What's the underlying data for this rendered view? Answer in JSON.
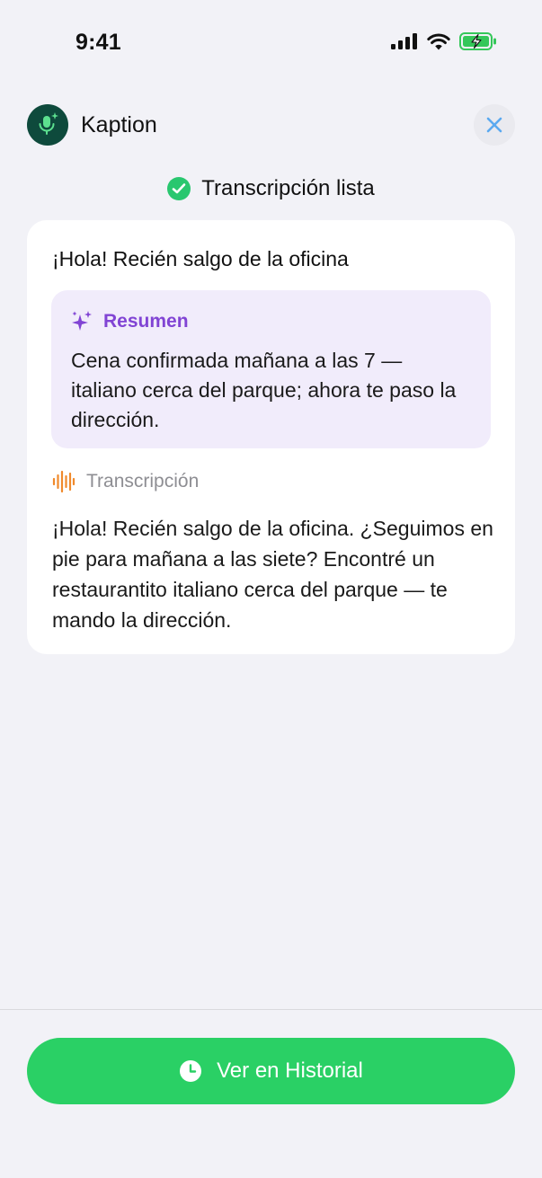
{
  "status_bar": {
    "time": "9:41"
  },
  "header": {
    "app_name": "Kaption"
  },
  "status": {
    "text": "Transcripción lista"
  },
  "card": {
    "title": "¡Hola! Recién salgo de la oficina",
    "summary": {
      "label": "Resumen",
      "text": "Cena confirmada mañana a las 7 — italiano cerca del parque; ahora te paso la dirección."
    },
    "transcription": {
      "label": "Transcripción",
      "text": "¡Hola! Recién salgo de la oficina. ¿Seguimos en pie para mañana a las siete? Encontré un restaurantito italiano cerca del parque — te mando la dirección."
    }
  },
  "footer": {
    "history_button": "Ver en Historial"
  },
  "colors": {
    "accent_green": "#2AD065",
    "summary_purple": "#8144D4",
    "transcription_orange": "#F08A2C",
    "app_icon_bg": "#0E4A3C",
    "close_blue": "#5AA9F0"
  },
  "icons": [
    "signal-icon",
    "wifi-icon",
    "battery-charging-icon",
    "microphone-sparkle-icon",
    "close-icon",
    "checkmark-circle-icon",
    "sparkles-icon",
    "waveform-icon",
    "clock-icon"
  ]
}
